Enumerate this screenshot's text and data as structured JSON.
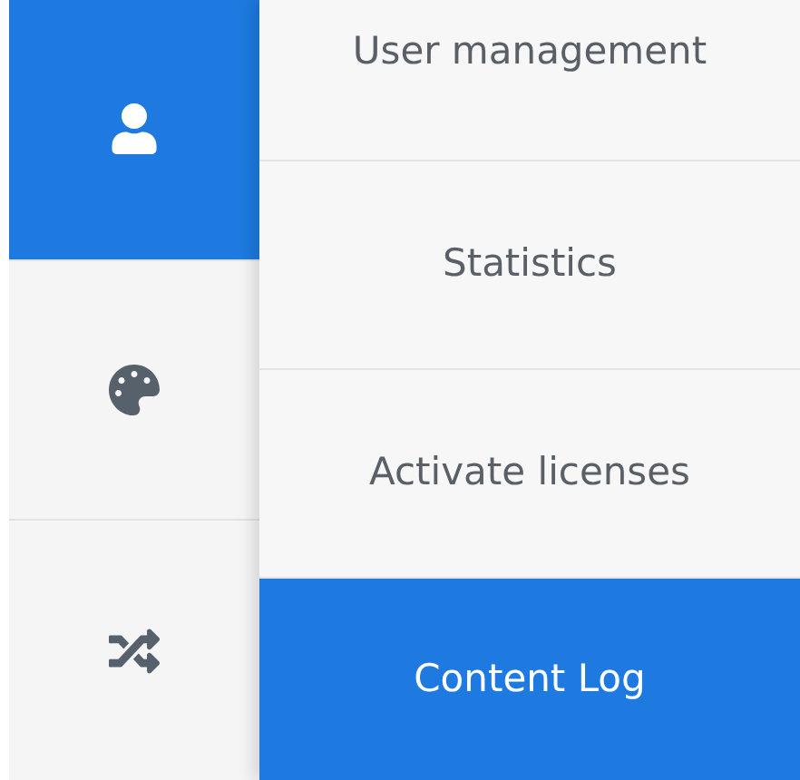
{
  "icon_bar": [
    {
      "kind": "user",
      "selected": true
    },
    {
      "kind": "palette",
      "selected": false
    },
    {
      "kind": "shuffle",
      "selected": false
    }
  ],
  "menu": [
    {
      "label": "User management",
      "selected": false
    },
    {
      "label": "Statistics",
      "selected": false
    },
    {
      "label": "Activate licenses",
      "selected": false
    },
    {
      "label": "Content Log",
      "selected": true
    }
  ]
}
